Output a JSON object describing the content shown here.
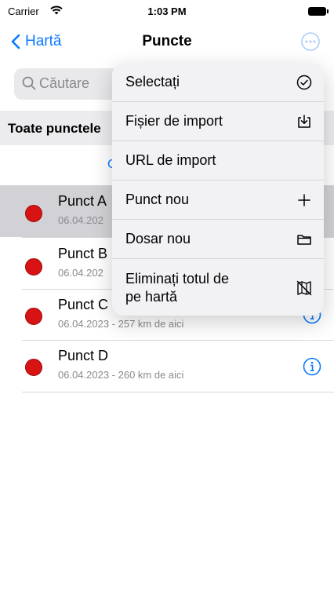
{
  "status_bar": {
    "carrier": "Carrier",
    "time": "1:03 PM"
  },
  "nav": {
    "back_label": "Hartă",
    "title": "Puncte"
  },
  "search": {
    "placeholder": "Căutare"
  },
  "section": {
    "title": "Toate punctele",
    "peek_text": "C"
  },
  "points": [
    {
      "name": "Punct A",
      "subtitle": "06.04.202",
      "selected": true
    },
    {
      "name": "Punct B",
      "subtitle": "06.04.202"
    },
    {
      "name": "Punct C",
      "subtitle": "06.04.2023 - 257 km de aici"
    },
    {
      "name": "Punct D",
      "subtitle": "06.04.2023 - 260 km de aici"
    }
  ],
  "menu": {
    "items": [
      {
        "label": "Selectați",
        "icon": "checkmark-circle-icon"
      },
      {
        "label": "Fișier de import",
        "icon": "tray-download-icon"
      },
      {
        "label": "URL de import",
        "icon": ""
      },
      {
        "label": "Punct nou",
        "icon": "plus-icon"
      },
      {
        "label": "Dosar nou",
        "icon": "folder-icon"
      },
      {
        "label_line1": "Eliminați totul de",
        "label_line2": "pe hartă",
        "icon": "map-slash-icon"
      }
    ]
  },
  "colors": {
    "accent": "#0a7aff",
    "pin": "#d71313"
  }
}
